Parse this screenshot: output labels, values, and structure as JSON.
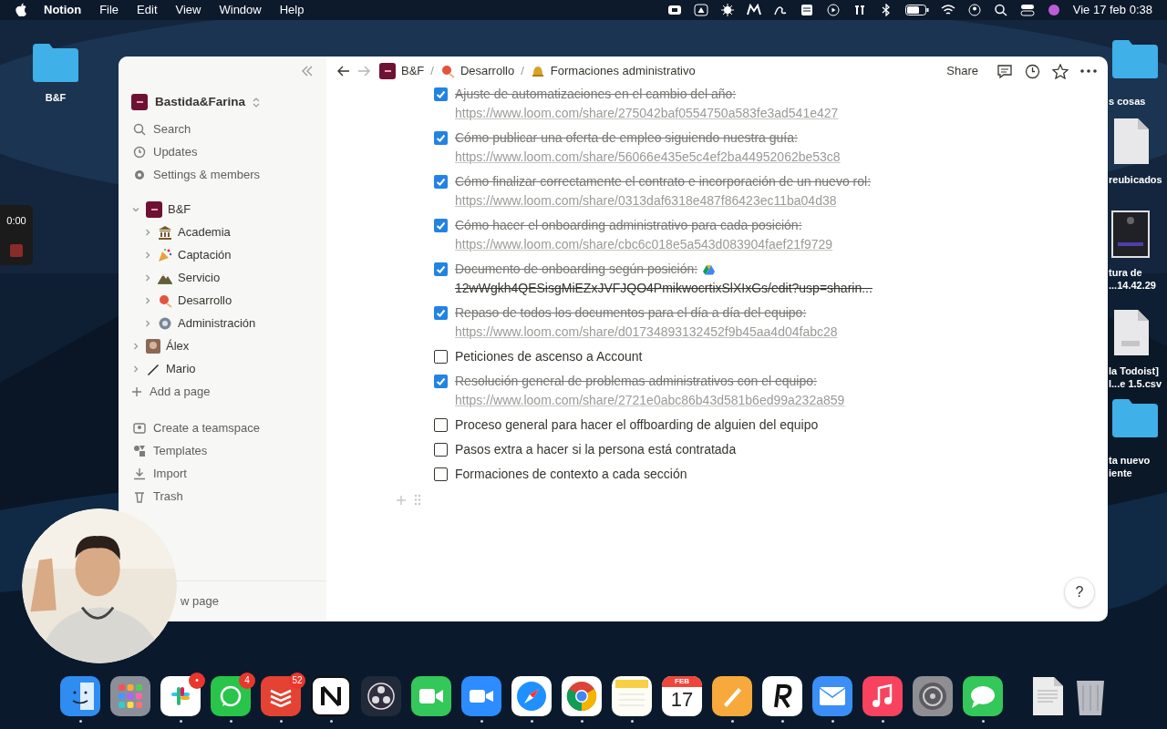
{
  "menu_bar": {
    "app": "Notion",
    "menus": [
      "File",
      "Edit",
      "View",
      "Window",
      "Help"
    ],
    "clock": "Vie 17 feb 0:38"
  },
  "recorder": {
    "time": "0:00"
  },
  "desktop_left": [
    {
      "kind": "folder",
      "lines": [
        "B&F"
      ]
    }
  ],
  "desktop_right": [
    {
      "kind": "folder",
      "lines": [
        "s cosas"
      ]
    },
    {
      "kind": "document",
      "lines": [
        "reubicados"
      ]
    },
    {
      "kind": "screenshot",
      "lines": [
        "tura de",
        "...14.42.29"
      ]
    },
    {
      "kind": "csv",
      "lines": [
        "la Todoist]",
        "l...e 1.5.csv"
      ]
    },
    {
      "kind": "folder",
      "lines": [
        "ta nuevo",
        "iente"
      ]
    }
  ],
  "sidebar": {
    "workspace": "Bastida&Farina",
    "nav": [
      "Search",
      "Updates",
      "Settings & members"
    ],
    "tree": [
      {
        "label": "B&F",
        "expanded": true,
        "children": [
          {
            "label": "Academia",
            "expanded": false
          },
          {
            "label": "Captación",
            "expanded": false
          },
          {
            "label": "Servicio",
            "expanded": false
          },
          {
            "label": "Desarrollo",
            "expanded": false
          },
          {
            "label": "Administración",
            "expanded": false
          }
        ]
      },
      {
        "label": "Álex",
        "expanded": false
      },
      {
        "label": "Mario",
        "expanded": false
      }
    ],
    "add_page": "Add a page",
    "extras": [
      "Create a teamspace",
      "Templates",
      "Import",
      "Trash"
    ],
    "new_page": "w page"
  },
  "topbar": {
    "breadcrumbs": [
      "B&F",
      "Desarrollo",
      "Formaciones administrativo"
    ],
    "separator": "/",
    "share": "Share"
  },
  "todos": [
    {
      "kind": "link",
      "checked": true,
      "text": "Ajuste de automatizaciones en el cambio del año:",
      "link": "https://www.loom.com/share/275042baf0554750a583fe3ad541e427"
    },
    {
      "kind": "link",
      "checked": true,
      "text": "Cómo publicar una oferta de empleo siguiendo nuestra guía:",
      "link": "https://www.loom.com/share/56066e435e5c4ef2ba44952062be53c8"
    },
    {
      "kind": "link",
      "checked": true,
      "text": "Cómo finalizar correctamente el contrato e incorporación de un nuevo rol:",
      "link": "https://www.loom.com/share/0313daf6318e487f86423ec11ba04d38"
    },
    {
      "kind": "link",
      "checked": true,
      "text": "Cómo hacer el onboarding administrativo para cada posición:",
      "link": "https://www.loom.com/share/cbc6c018e5a543d083904faef21f9729"
    },
    {
      "kind": "drive",
      "checked": true,
      "text": "Documento de onboarding según posición:",
      "link": "12wWgkh4QESisgMiEZxJVFJQO4PmikwocrtixSlXIxGs/edit?usp=sharin..."
    },
    {
      "kind": "link",
      "checked": true,
      "text": "Repaso de todos los documentos para el día a día del equipo:",
      "link": "https://www.loom.com/share/d01734893132452f9b45aa4d04fabc28"
    },
    {
      "kind": "plain",
      "checked": false,
      "text": "Peticiones de ascenso a Account"
    },
    {
      "kind": "link",
      "checked": true,
      "text": "Resolución general de problemas administrativos con el equipo:",
      "link": "https://www.loom.com/share/2721e0abc86b43d581b6ed99a232a859"
    },
    {
      "kind": "plain",
      "checked": false,
      "text": "Proceso general para hacer el offboarding de alguien del equipo"
    },
    {
      "kind": "plain",
      "checked": false,
      "text": "Pasos extra a hacer si la persona está contratada"
    },
    {
      "kind": "plain",
      "checked": false,
      "text": "Formaciones de contexto a cada sección"
    }
  ],
  "help": "?",
  "dock": [
    {
      "kind": "finder",
      "running": true
    },
    {
      "kind": "launchpad",
      "running": false
    },
    {
      "kind": "slack",
      "running": true,
      "badge": "•"
    },
    {
      "kind": "whatsapp",
      "running": true,
      "badge": "4"
    },
    {
      "kind": "todoist",
      "running": true,
      "badge": "52"
    },
    {
      "kind": "notion",
      "running": true
    },
    {
      "kind": "obs",
      "running": false
    },
    {
      "kind": "facetime",
      "running": false
    },
    {
      "kind": "zoom",
      "running": true
    },
    {
      "kind": "safari",
      "running": true
    },
    {
      "kind": "chrome",
      "running": true
    },
    {
      "kind": "notes",
      "running": true
    },
    {
      "kind": "calendar",
      "running": false,
      "month": "FEB",
      "day": "17"
    },
    {
      "kind": "pages",
      "running": true
    },
    {
      "kind": "reeder",
      "running": true
    },
    {
      "kind": "mail",
      "running": true
    },
    {
      "kind": "music",
      "running": true
    },
    {
      "kind": "settings",
      "running": false
    },
    {
      "kind": "messages",
      "running": true
    },
    {
      "kind": "divider"
    },
    {
      "kind": "pdf",
      "running": false
    },
    {
      "kind": "trash",
      "running": false
    }
  ]
}
